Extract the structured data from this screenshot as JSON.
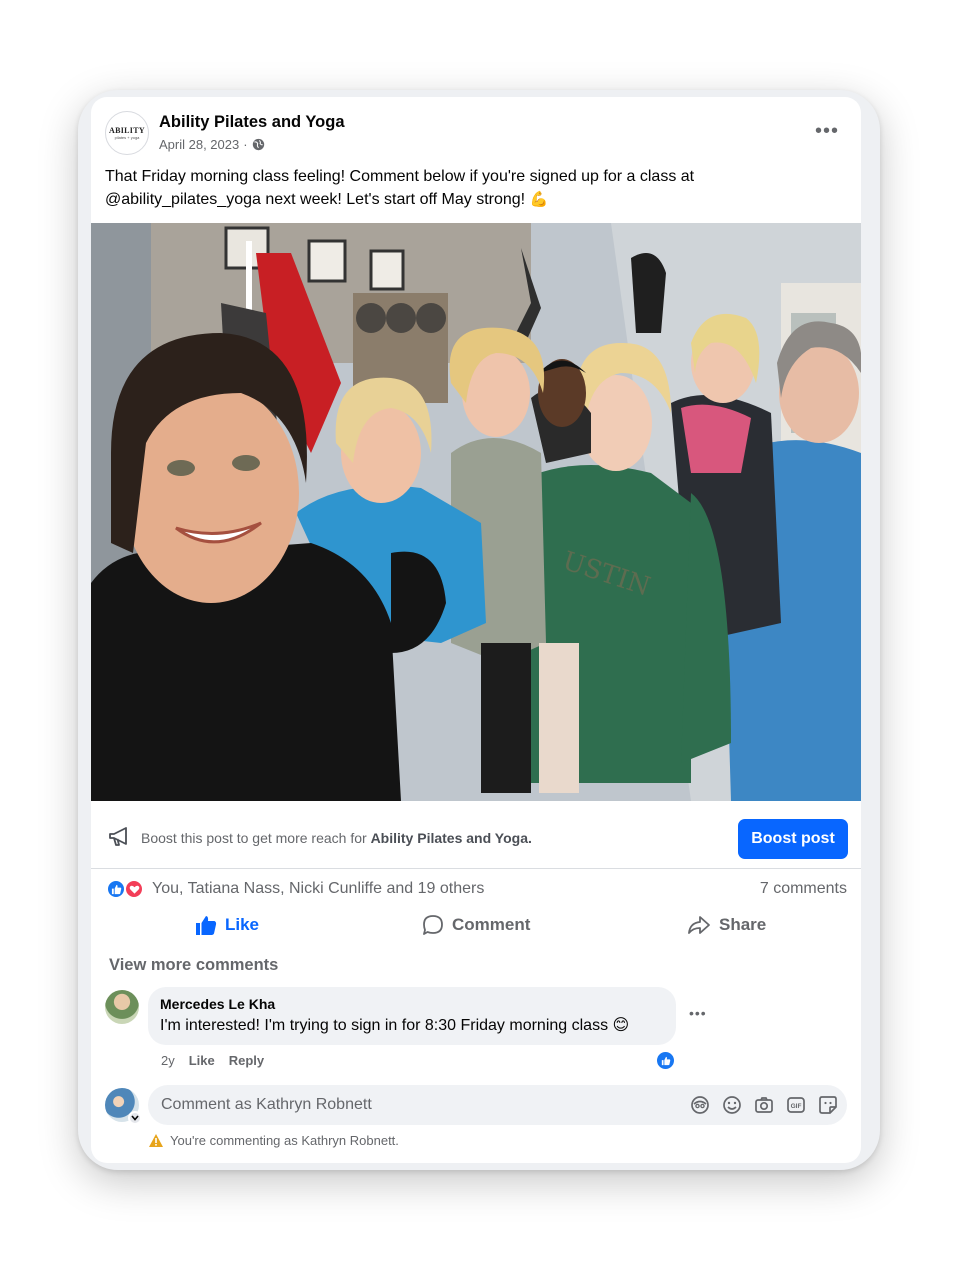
{
  "post": {
    "page_name": "Ability Pilates and Yoga",
    "logo_text": "ABILITY",
    "logo_subtext": "pilates + yoga",
    "date": "April 28, 2023",
    "meta_separator": "·",
    "audience_icon": "globe-icon",
    "more_icon": "•••",
    "caption": "That Friday morning class feeling! Comment below if you're signed up for a class at @ability_pilates_yoga next week! Let's start off May strong!",
    "caption_emoji": "💪"
  },
  "boost": {
    "text_prefix": "Boost this post to get more reach for",
    "page_name": "Ability Pilates and Yoga.",
    "button_label": "Boost post"
  },
  "reactions": {
    "reactors": "You, Tatiana Nass, Nicki Cunliffe and 19 others",
    "comment_count": "7 comments"
  },
  "actions": {
    "like": "Like",
    "comment": "Comment",
    "share": "Share"
  },
  "comments": {
    "view_more": "View more comments",
    "items": [
      {
        "author": "Mercedes Le Kha",
        "text": "I'm interested! I'm trying to sign in for 8:30 Friday morning class",
        "emoji": "😊",
        "age": "2y",
        "like_label": "Like",
        "reply_label": "Reply",
        "more_icon": "•••"
      }
    ]
  },
  "composer": {
    "placeholder": "Comment as Kathryn Robnett",
    "warning": "You're commenting as Kathryn Robnett.",
    "tools": [
      "avatar-sticker-icon",
      "emoji-icon",
      "camera-icon",
      "gif-icon",
      "sticker-icon"
    ],
    "gif_label": "GIF"
  },
  "colors": {
    "accent": "#0866ff",
    "like_blue": "#1877f2",
    "love_red": "#f33e58",
    "secondary_text": "#65676b",
    "bubble_bg": "#f0f2f5",
    "warning_yellow": "#e7a41b"
  }
}
